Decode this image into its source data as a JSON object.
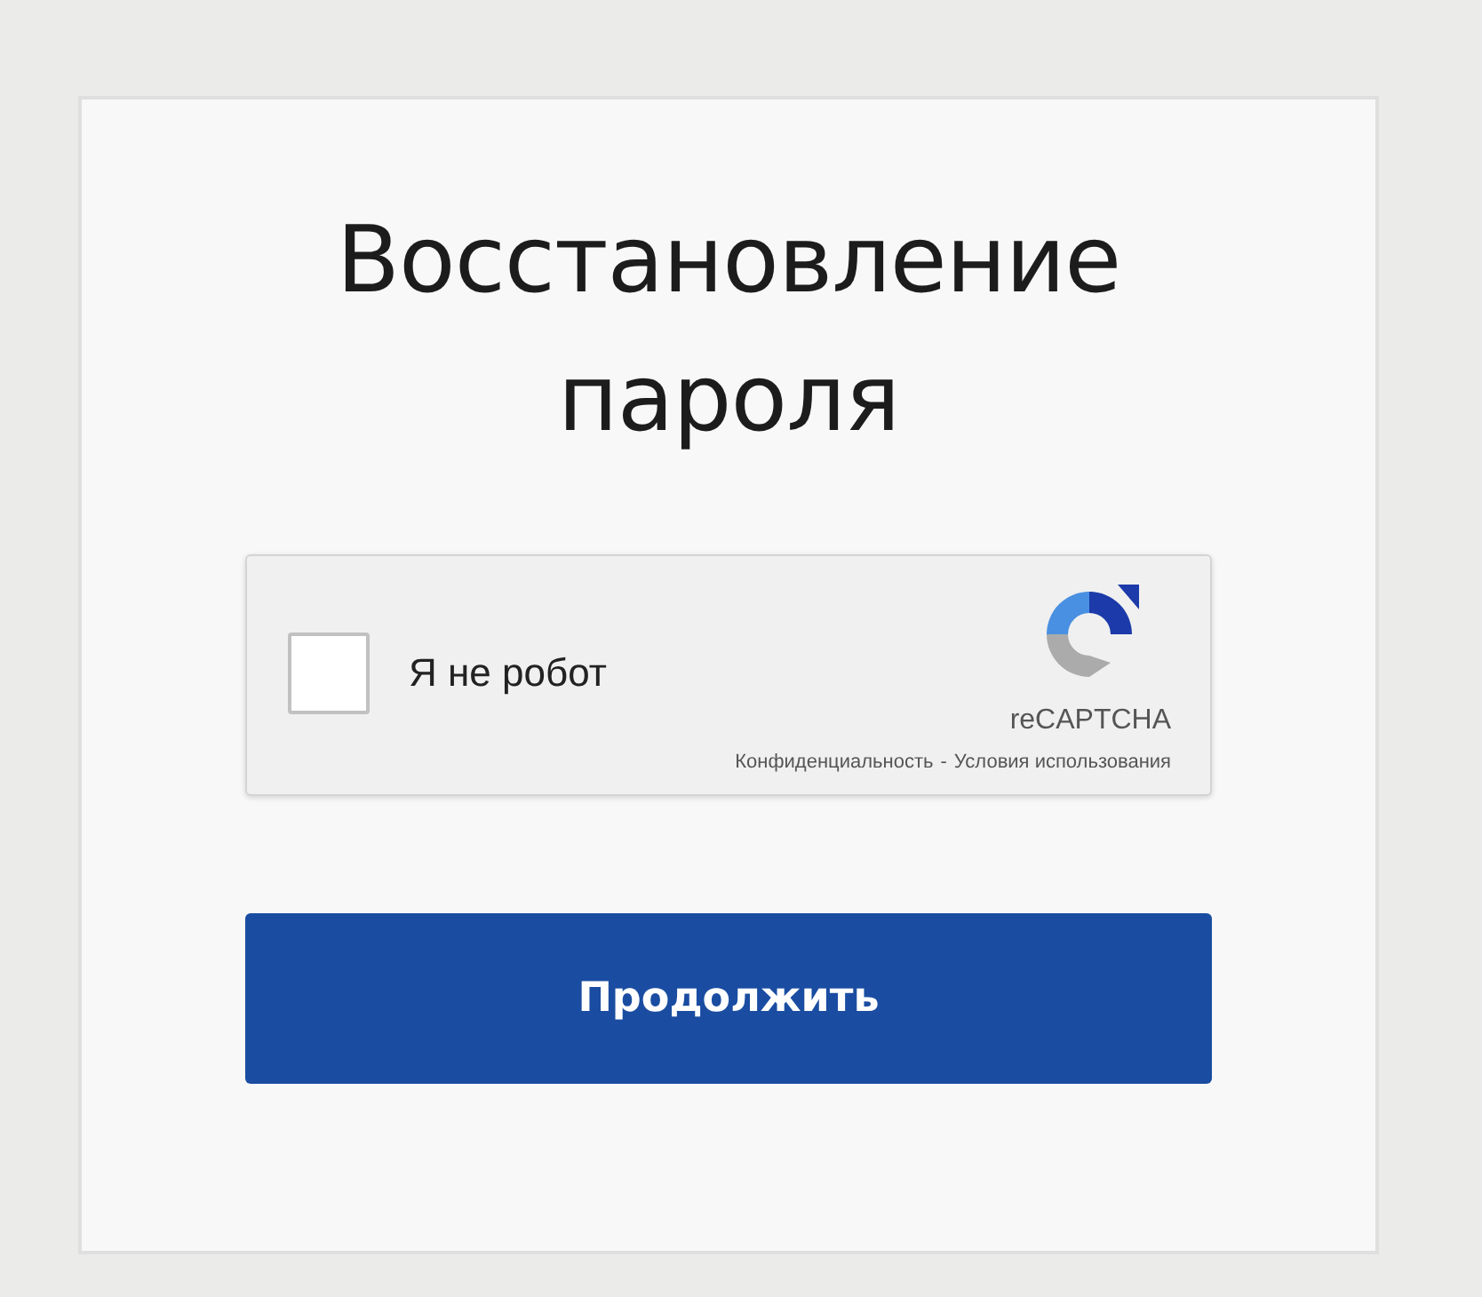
{
  "title": "Восстановление пароля",
  "captcha": {
    "checked": false,
    "label": "Я не робот",
    "brand": "reCAPTCHA",
    "privacy": "Конфиденциальность",
    "separator": "-",
    "terms": "Условия использования"
  },
  "submit": {
    "label": "Продолжить"
  }
}
